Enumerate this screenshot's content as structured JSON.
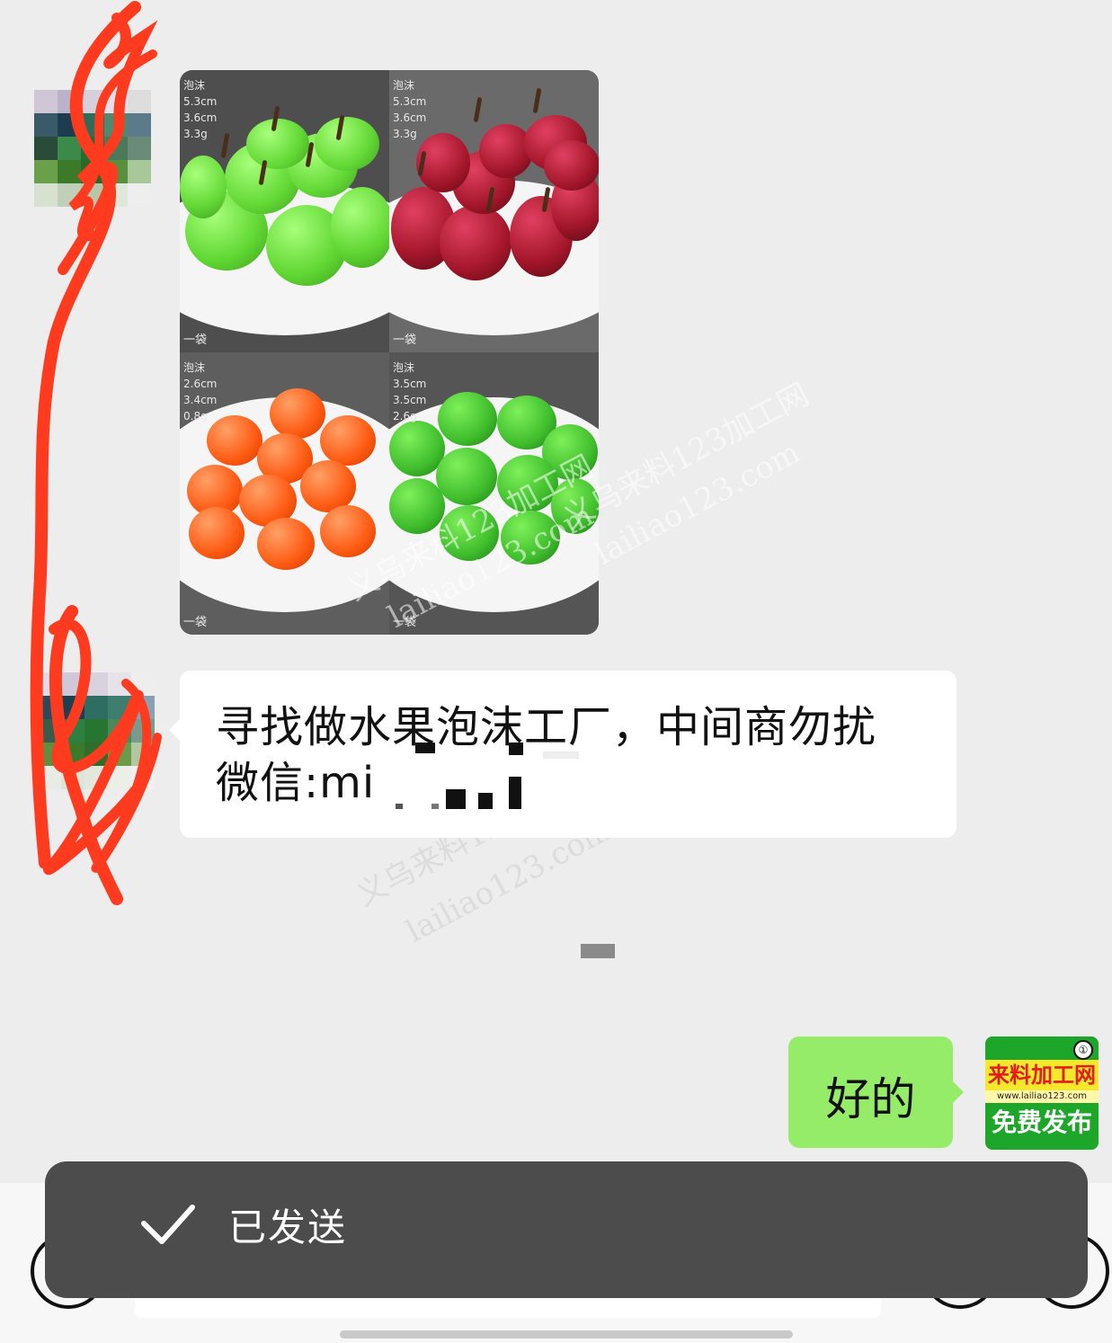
{
  "photo": {
    "quadrants": [
      {
        "material": "泡沫",
        "dims": [
          "5.3cm",
          "3.6cm",
          "3.3g"
        ],
        "unit": "一袋",
        "fruit": "green-apple",
        "color": "#6fe03a"
      },
      {
        "material": "泡沫",
        "dims": [
          "5.3cm",
          "3.6cm",
          "3.3g"
        ],
        "unit": "一袋",
        "fruit": "red-apple",
        "color": "#a3162a"
      },
      {
        "material": "泡沫",
        "dims": [
          "2.6cm",
          "3.4cm",
          "0.8g"
        ],
        "unit": "一袋",
        "fruit": "orange",
        "color": "#ff5a12"
      },
      {
        "material": "泡沫",
        "dims": [
          "3.5cm",
          "3.5cm",
          "2.6g"
        ],
        "unit": "一袋",
        "fruit": "green-citrus",
        "color": "#3fbd2c"
      }
    ]
  },
  "messages": {
    "incoming_text": "寻找做水果泡沫工厂，中间商勿扰\n微信:mi",
    "outgoing_text": "好的"
  },
  "watermark": {
    "line1": "义乌来料123加工网",
    "line2": "lailiao123.com"
  },
  "my_avatar": {
    "title": "来料加工网",
    "url": "www.lailiao123.com",
    "slogan": "免费发布",
    "badge": "①"
  },
  "toast": {
    "label": "已发送"
  },
  "colors": {
    "chat_bg": "#ededed",
    "outgoing_bubble": "#95ec69",
    "incoming_bubble": "#ffffff",
    "toast_bg": "#4c4c4c",
    "scribble": "#ff3b1f"
  }
}
